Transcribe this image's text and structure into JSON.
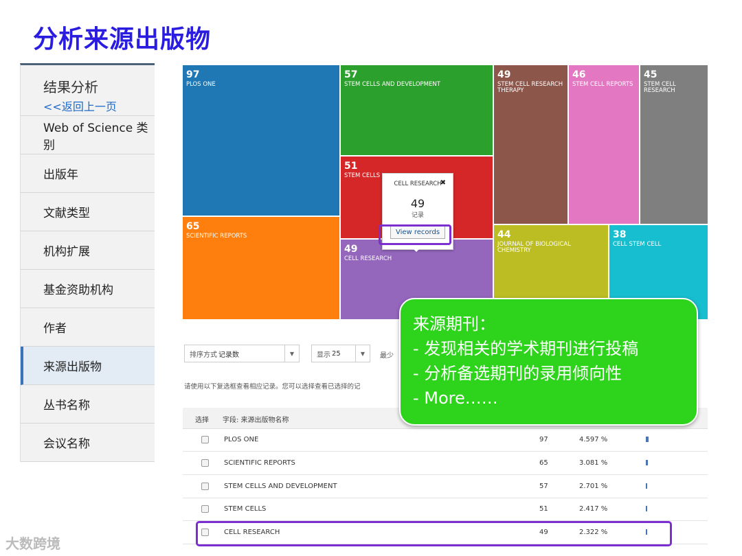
{
  "slide_title": "分析来源出版物",
  "sidebar": {
    "heading": "结果分析",
    "back_link": "<<返回上一页",
    "items": [
      {
        "label": "Web of Science 类别"
      },
      {
        "label": "出版年"
      },
      {
        "label": "文献类型"
      },
      {
        "label": "机构扩展"
      },
      {
        "label": "基金资助机构"
      },
      {
        "label": "作者"
      },
      {
        "label": "来源出版物",
        "active": true
      },
      {
        "label": "丛书名称"
      },
      {
        "label": "会议名称"
      }
    ]
  },
  "treemap": {
    "tiles": [
      {
        "count": "97",
        "label": "PLOS ONE",
        "color": "#1f77b4"
      },
      {
        "count": "57",
        "label": "STEM CELLS AND DEVELOPMENT",
        "color": "#2ca02c"
      },
      {
        "count": "49",
        "label": "STEM CELL RESEARCH THERAPY",
        "color": "#8c564b"
      },
      {
        "count": "46",
        "label": "STEM CELL REPORTS",
        "color": "#e377c2"
      },
      {
        "count": "45",
        "label": "STEM CELL RESEARCH",
        "color": "#7f7f7f"
      },
      {
        "count": "51",
        "label": "STEM CELLS",
        "color": "#d62728"
      },
      {
        "count": "65",
        "label": "SCIENTIFIC REPORTS",
        "color": "#ff7f0e"
      },
      {
        "count": "49",
        "label": "CELL RESEARCH",
        "color": "#9467bd"
      },
      {
        "count": "44",
        "label": "JOURNAL OF BIOLOGICAL CHEMISTRY",
        "color": "#bcbd22"
      },
      {
        "count": "38",
        "label": "CELL STEM CELL",
        "color": "#17becf"
      }
    ],
    "tooltip": {
      "title": "CELL RESEARCH",
      "count": "49",
      "unit": "记录",
      "button": "View records"
    }
  },
  "controls": {
    "sort_label": "排序方式",
    "sort_value": "记录数",
    "show_label": "显示",
    "show_value": "25",
    "min_label": "最少",
    "hint": "请使用以下复选框查看相应记录。您可以选择查看已选择的记"
  },
  "table": {
    "col_select": "选择",
    "col_field": "字段: 来源出版物名称",
    "rows": [
      {
        "name": "PLOS ONE",
        "count": "97",
        "percent": "4.597 %",
        "bar_fraction": 0.04597
      },
      {
        "name": "SCIENTIFIC REPORTS",
        "count": "65",
        "percent": "3.081 %",
        "bar_fraction": 0.03081
      },
      {
        "name": "STEM CELLS AND DEVELOPMENT",
        "count": "57",
        "percent": "2.701 %",
        "bar_fraction": 0.02701
      },
      {
        "name": "STEM CELLS",
        "count": "51",
        "percent": "2.417 %",
        "bar_fraction": 0.02417
      },
      {
        "name": "CELL RESEARCH",
        "count": "49",
        "percent": "2.322 %",
        "bar_fraction": 0.02322
      }
    ]
  },
  "callout": {
    "lines": [
      "来源期刊：",
      "- 发现相关的学术期刊进行投稿",
      "- 分析备选期刊的录用倾向性",
      "- More……"
    ]
  },
  "watermark": "大数跨境",
  "colors": {
    "title": "#2a1de0",
    "highlight": "#7b2fd1",
    "callout": "#2ed31c",
    "link": "#1b6ac9"
  }
}
